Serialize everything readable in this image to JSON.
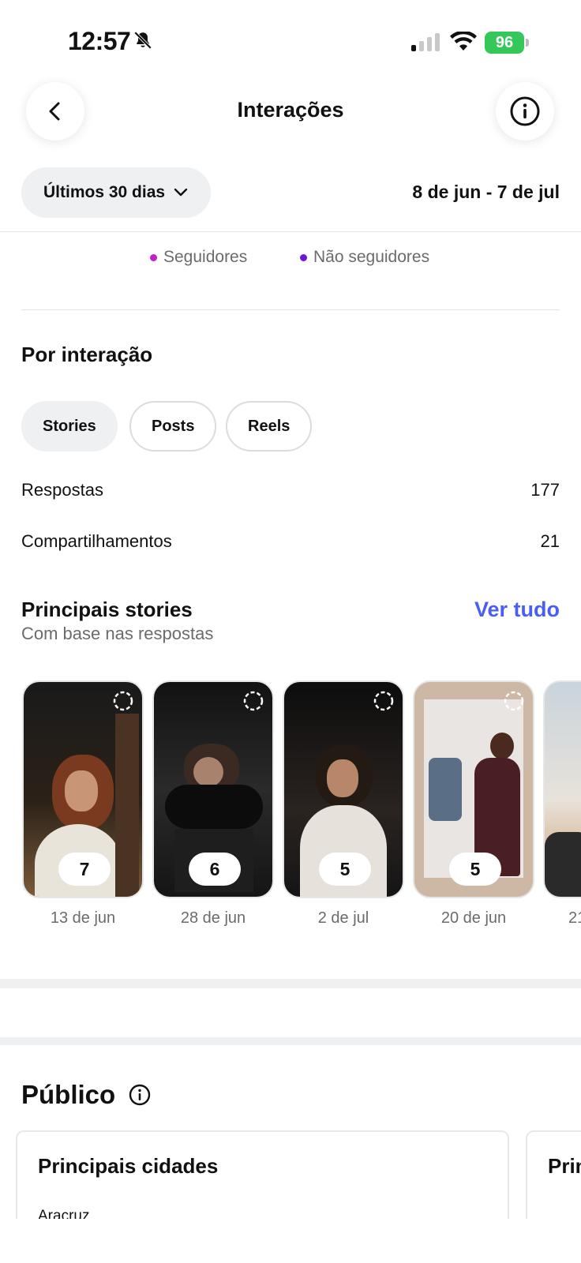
{
  "status_bar": {
    "time": "12:57",
    "battery": "96",
    "icons": [
      "bell-slash-icon",
      "signal-icon",
      "wifi-icon",
      "battery-charging-icon"
    ]
  },
  "header": {
    "title": "Interações",
    "back_icon": "chevron-left-icon",
    "info_icon": "info-icon"
  },
  "range": {
    "label": "Últimos 30 dias",
    "dates": "8 de jun - 7 de jul"
  },
  "legend": [
    {
      "label": "Seguidores",
      "color": "#c320c9"
    },
    {
      "label": "Não seguidores",
      "color": "#6a18d9"
    }
  ],
  "by_interaction": {
    "title": "Por interação",
    "tabs": [
      "Stories",
      "Posts",
      "Reels"
    ],
    "active_tab": "Stories",
    "metrics": [
      {
        "label": "Respostas",
        "value": "177"
      },
      {
        "label": "Compartilhamentos",
        "value": "21"
      }
    ]
  },
  "top_stories": {
    "title": "Principais stories",
    "subtitle": "Com base nas respostas",
    "see_all": "Ver tudo",
    "items": [
      {
        "count": "7",
        "date": "13 de jun"
      },
      {
        "count": "6",
        "date": "28 de jun"
      },
      {
        "count": "5",
        "date": "2 de jul"
      },
      {
        "count": "5",
        "date": "20 de jun"
      },
      {
        "count": "",
        "date": "21"
      }
    ]
  },
  "public": {
    "title": "Público",
    "cards": [
      {
        "title": "Principais cidades",
        "first_item": "Aracruz"
      },
      {
        "title": "Prin",
        "first_item": ""
      }
    ]
  },
  "accent_color": "#4a5df9"
}
